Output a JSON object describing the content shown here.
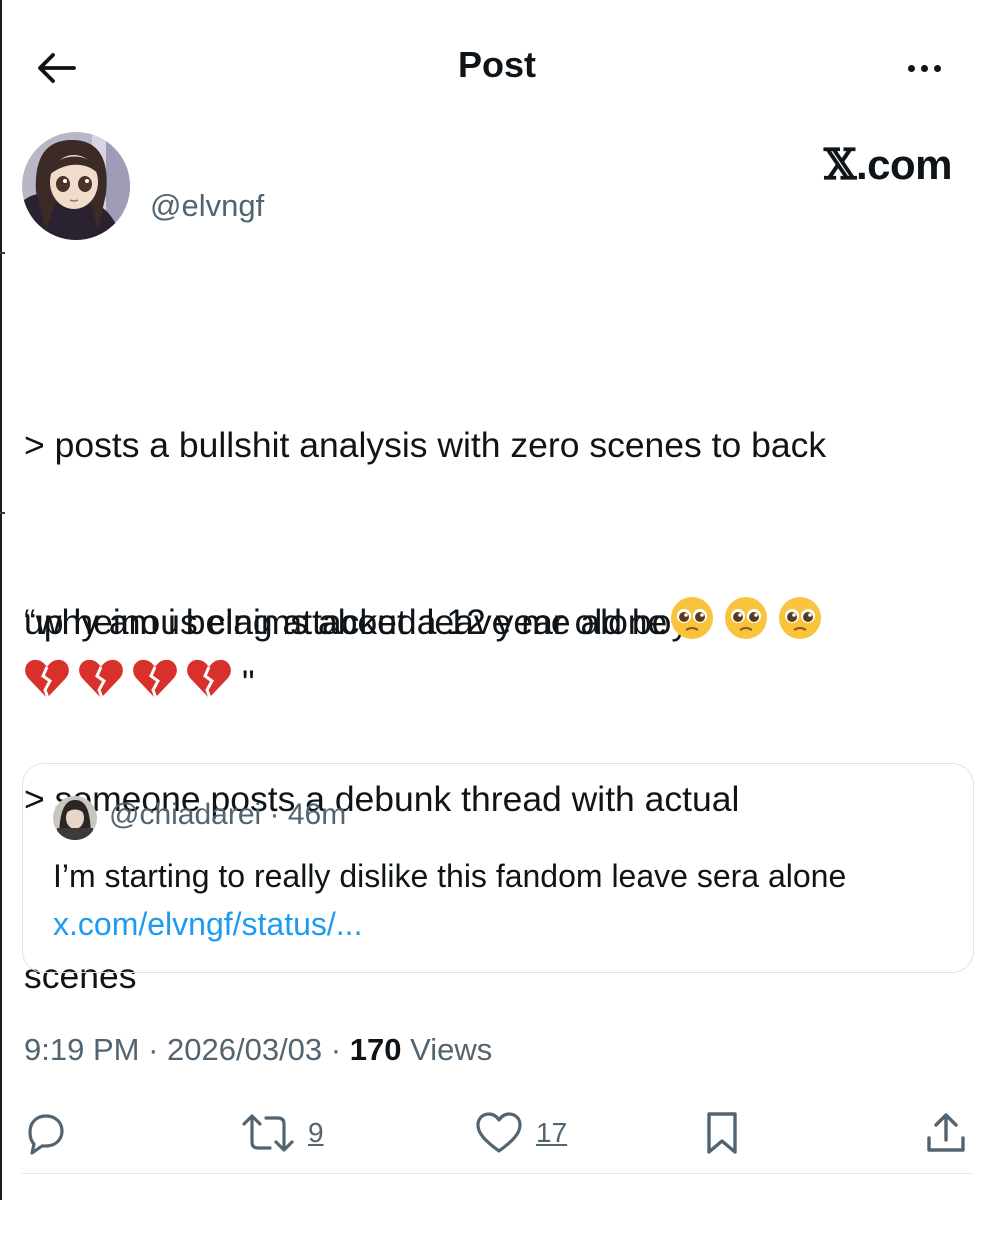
{
  "header": {
    "title": "Post",
    "back_icon": "arrow-left-icon",
    "more_icon": "more-horizontal-icon"
  },
  "author": {
    "handle": "@elvngf",
    "brand_x": "𝕏",
    "brand_suffix": ".com"
  },
  "post": {
    "lines": [
      "> posts a bullshit analysis with zero scenes to back",
      "up heinous claims about a 12 year old boy",
      "> someone posts a debunk thread with actual",
      "scenes",
      "",
      "“why am i being attacked leave me alone"
    ],
    "emoji_pleading": "pleading-face-emoji",
    "emoji_broken_heart": "broken-heart-emoji",
    "close_quote": "\""
  },
  "quote": {
    "handle": "@chiadarei",
    "time": "46m",
    "text": "I’m starting to really dislike this fandom leave sera alone",
    "link": "x.com/elvngf/status/..."
  },
  "meta": {
    "time": "9:19 PM",
    "date": "2026/03/03",
    "views_count": "170",
    "views_label": "Views"
  },
  "actions": {
    "reply_icon": "reply-icon",
    "repost_icon": "repost-icon",
    "repost_count": "9",
    "like_icon": "heart-icon",
    "like_count": "17",
    "bookmark_icon": "bookmark-icon",
    "share_icon": "share-icon"
  },
  "colors": {
    "text": "#0f1419",
    "secondary": "#536471",
    "link": "#1d9bf0",
    "border": "#dfe3e6"
  }
}
